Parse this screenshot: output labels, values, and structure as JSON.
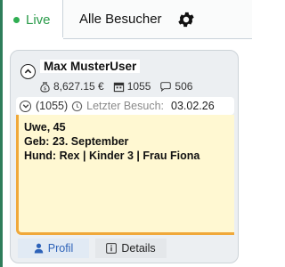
{
  "tabs": {
    "live_label": "Live",
    "besucher_label": "Alle Besucher",
    "settings_icon": "gear-icon"
  },
  "colors": {
    "live_green": "#2a9b4a",
    "note_bg": "#fff8d2",
    "note_border": "#f0a83a",
    "profil_blue": "#2d62b8"
  },
  "visitor": {
    "name": "Max MusterUser",
    "balance": "8,627.15 €",
    "visits": "1055",
    "messages": "506",
    "visit_count": "(1055)",
    "last_visit_label": "Letzter Besuch:",
    "last_visit_date": "03.02.26"
  },
  "note": {
    "line1": "Uwe, 45",
    "line2": "Geb: 23. September",
    "line3": "Hund: Rex | Kinder 3 | Frau Fiona"
  },
  "bottom_tabs": {
    "profil_label": "Profil",
    "details_label": "Details"
  }
}
